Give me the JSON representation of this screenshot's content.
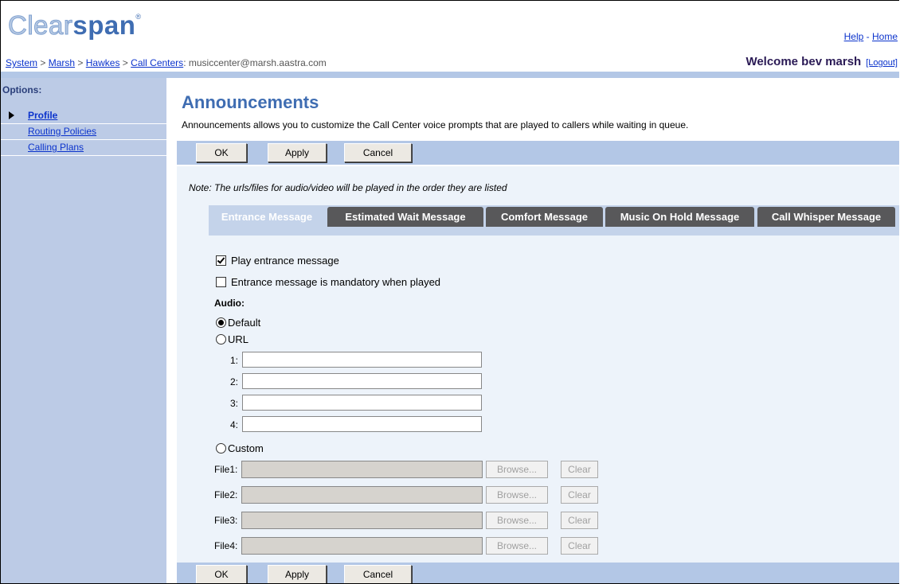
{
  "header": {
    "logo_light": "Clear",
    "logo_dark": "span",
    "help": "Help",
    "separator": "-",
    "home": "Home"
  },
  "breadcrumb": {
    "items": [
      "System",
      "Marsh",
      "Hawkes",
      "Call Centers"
    ],
    "sep": ">",
    "current": ": musiccenter@marsh.aastra.com"
  },
  "welcome": {
    "text": "Welcome bev marsh",
    "logout": "[Logout]"
  },
  "sidebar": {
    "heading": "Options:",
    "items": [
      {
        "label": "Profile",
        "selected": true
      },
      {
        "label": "Routing Policies",
        "selected": false
      },
      {
        "label": "Calling Plans",
        "selected": false
      }
    ]
  },
  "page": {
    "title": "Announcements",
    "description": "Announcements allows you to customize the Call Center voice prompts that are played to callers while waiting in queue."
  },
  "buttons": {
    "ok": "OK",
    "apply": "Apply",
    "cancel": "Cancel"
  },
  "note": "Note: The urls/files for audio/video will be played in the order they are listed",
  "tabs": [
    {
      "label": "Entrance Message",
      "active": true
    },
    {
      "label": "Estimated Wait Message",
      "active": false
    },
    {
      "label": "Comfort Message",
      "active": false
    },
    {
      "label": "Music On Hold Message",
      "active": false
    },
    {
      "label": "Call Whisper Message",
      "active": false
    }
  ],
  "form": {
    "play_entrance": {
      "label": "Play entrance message",
      "checked": true
    },
    "mandatory": {
      "label": "Entrance message is mandatory when played",
      "checked": false
    },
    "audio_label": "Audio:",
    "audio_options": {
      "default": "Default",
      "url": "URL",
      "custom": "Custom",
      "selected": "Default"
    },
    "url_labels": [
      "1:",
      "2:",
      "3:",
      "4:"
    ],
    "url_values": [
      "",
      "",
      "",
      ""
    ],
    "file_labels": [
      "File1:",
      "File2:",
      "File3:",
      "File4:"
    ],
    "browse": "Browse...",
    "clear": "Clear"
  }
}
